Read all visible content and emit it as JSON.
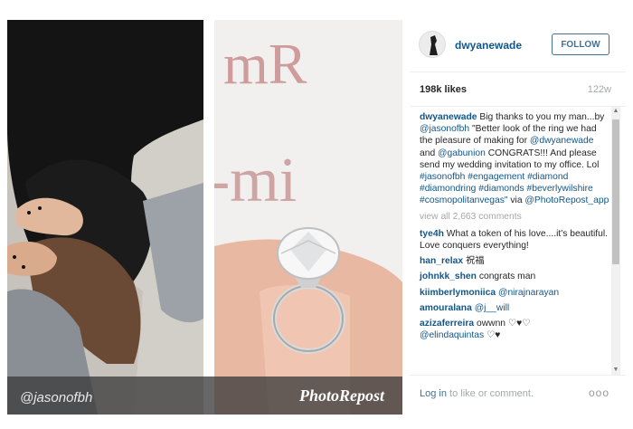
{
  "post": {
    "credit_handle": "@jasonofbh",
    "credit_app": "PhotoRepost",
    "photo_letters_top": "mR",
    "photo_letters_mid": "-mi"
  },
  "header": {
    "username": "dwyanewade",
    "follow_label": "FOLLOW"
  },
  "stats": {
    "likes": "198k likes",
    "age": "122w"
  },
  "caption": {
    "user": "dwyanewade",
    "t1": " Big thanks to you my man...by ",
    "m1": "@jasonofbh",
    "t2": " \"Better look of the ring we had the pleasure of making for ",
    "m2": "@dwyanewade",
    "t3": " and ",
    "m3": "@gabunion",
    "t4": " CONGRATS!!! And please send my wedding invitation to my office. Lol ",
    "tags": "#jasonofbh #engagement #diamond #diamondring #diamonds #beverlywilshire #cosmopolitanvegas\"",
    "t5": " via ",
    "m4": "@PhotoRepost_app"
  },
  "view_all": "view all 2,663 comments",
  "comments": [
    {
      "user": "tye4h",
      "text": " What a token of his love....it's beautiful. Love conquers everything!"
    },
    {
      "user": "han_relax",
      "text": " 祝福"
    },
    {
      "user": "johnkk_shen",
      "text": " congrats man"
    },
    {
      "user": "kiimberlymoniica",
      "text": " ",
      "mention": "@nirajnarayan"
    },
    {
      "user": "amouralana",
      "text": " ",
      "mention": "@j__will"
    },
    {
      "user": "azizaferreira",
      "text": " owwnn ♡♥♡",
      "mention": "@elindaquintas",
      "tail": " ♡♥"
    }
  ],
  "footer": {
    "login_link": "Log in",
    "login_rest": " to like or comment.",
    "more": "ooo"
  }
}
